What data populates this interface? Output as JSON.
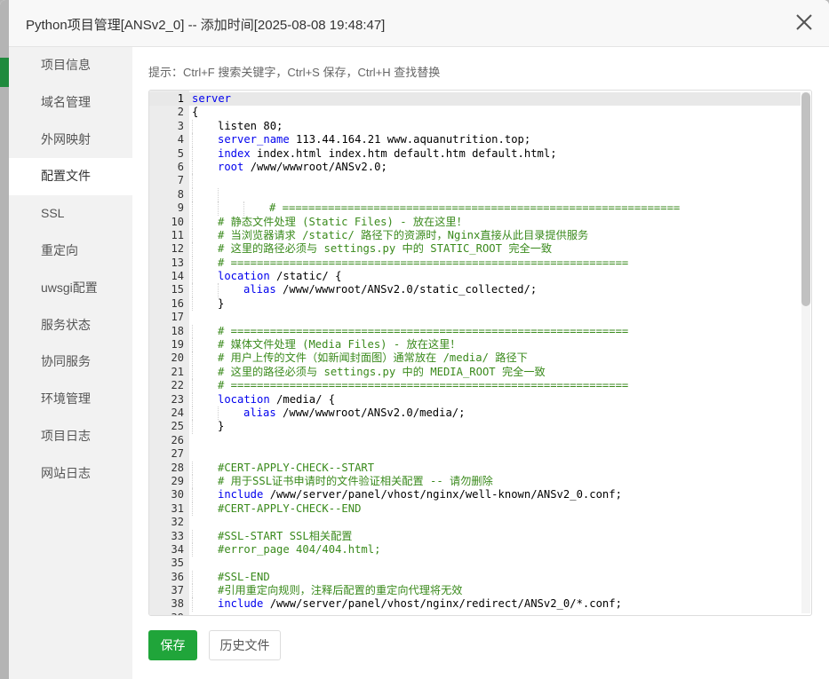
{
  "window": {
    "title": "Python项目管理[ANSv2_0] -- 添加时间[2025-08-08 19:48:47]"
  },
  "sidebar": {
    "items": [
      {
        "label": "项目信息",
        "active": false
      },
      {
        "label": "域名管理",
        "active": false
      },
      {
        "label": "外网映射",
        "active": false
      },
      {
        "label": "配置文件",
        "active": true
      },
      {
        "label": "SSL",
        "active": false
      },
      {
        "label": "重定向",
        "active": false
      },
      {
        "label": "uwsgi配置",
        "active": false
      },
      {
        "label": "服务状态",
        "active": false
      },
      {
        "label": "协同服务",
        "active": false
      },
      {
        "label": "环境管理",
        "active": false
      },
      {
        "label": "项目日志",
        "active": false
      },
      {
        "label": "网站日志",
        "active": false
      }
    ]
  },
  "editor": {
    "hint": "提示：Ctrl+F 搜索关键字，Ctrl+S 保存，Ctrl+H 查找替换",
    "active_line": 1,
    "scroll_fraction_visible": 0.41,
    "lines": [
      {
        "n": 1,
        "indent": 0,
        "segments": [
          [
            "kw",
            "server"
          ]
        ]
      },
      {
        "n": 2,
        "indent": 0,
        "segments": [
          [
            "t",
            "{"
          ]
        ]
      },
      {
        "n": 3,
        "indent": 1,
        "segments": [
          [
            "t",
            "listen 80;"
          ]
        ]
      },
      {
        "n": 4,
        "indent": 1,
        "segments": [
          [
            "kw",
            "server_name"
          ],
          [
            "t",
            " 113.44.164.21 www.aquanutrition.top;"
          ]
        ]
      },
      {
        "n": 5,
        "indent": 1,
        "segments": [
          [
            "kw",
            "index"
          ],
          [
            "t",
            " index.html index.htm default.htm default.html;"
          ]
        ]
      },
      {
        "n": 6,
        "indent": 1,
        "segments": [
          [
            "kw",
            "root"
          ],
          [
            "t",
            " /www/wwwroot/ANSv2.0;"
          ]
        ]
      },
      {
        "n": 7,
        "indent": 1,
        "segments": []
      },
      {
        "n": 8,
        "indent": 2,
        "segments": []
      },
      {
        "n": 9,
        "indent": 3,
        "segments": [
          [
            "cm",
            "# ============================================================="
          ]
        ]
      },
      {
        "n": 10,
        "indent": 1,
        "segments": [
          [
            "cm",
            "# 静态文件处理 (Static Files) - 放在这里！"
          ]
        ]
      },
      {
        "n": 11,
        "indent": 1,
        "segments": [
          [
            "cm",
            "# 当浏览器请求 /static/ 路径下的资源时，Nginx直接从此目录提供服务"
          ]
        ]
      },
      {
        "n": 12,
        "indent": 1,
        "segments": [
          [
            "cm",
            "# 这里的路径必须与 settings.py 中的 STATIC_ROOT 完全一致"
          ]
        ]
      },
      {
        "n": 13,
        "indent": 1,
        "segments": [
          [
            "cm",
            "# ============================================================="
          ]
        ]
      },
      {
        "n": 14,
        "indent": 1,
        "segments": [
          [
            "kw",
            "location"
          ],
          [
            "t",
            " /static/ {"
          ]
        ]
      },
      {
        "n": 15,
        "indent": 2,
        "segments": [
          [
            "kw",
            "alias"
          ],
          [
            "t",
            " /www/wwwroot/ANSv2.0/static_collected/;"
          ]
        ]
      },
      {
        "n": 16,
        "indent": 1,
        "segments": [
          [
            "t",
            "}"
          ]
        ]
      },
      {
        "n": 17,
        "indent": 0,
        "segments": []
      },
      {
        "n": 18,
        "indent": 1,
        "segments": [
          [
            "cm",
            "# ============================================================="
          ]
        ]
      },
      {
        "n": 19,
        "indent": 1,
        "segments": [
          [
            "cm",
            "# 媒体文件处理 (Media Files) - 放在这里！"
          ]
        ]
      },
      {
        "n": 20,
        "indent": 1,
        "segments": [
          [
            "cm",
            "# 用户上传的文件（如新闻封面图）通常放在 /media/ 路径下"
          ]
        ]
      },
      {
        "n": 21,
        "indent": 1,
        "segments": [
          [
            "cm",
            "# 这里的路径必须与 settings.py 中的 MEDIA_ROOT 完全一致"
          ]
        ]
      },
      {
        "n": 22,
        "indent": 1,
        "segments": [
          [
            "cm",
            "# ============================================================="
          ]
        ]
      },
      {
        "n": 23,
        "indent": 1,
        "segments": [
          [
            "kw",
            "location"
          ],
          [
            "t",
            " /media/ {"
          ]
        ]
      },
      {
        "n": 24,
        "indent": 2,
        "segments": [
          [
            "kw",
            "alias"
          ],
          [
            "t",
            " /www/wwwroot/ANSv2.0/media/;"
          ]
        ]
      },
      {
        "n": 25,
        "indent": 1,
        "segments": [
          [
            "t",
            "}"
          ]
        ]
      },
      {
        "n": 26,
        "indent": 0,
        "segments": []
      },
      {
        "n": 27,
        "indent": 0,
        "segments": []
      },
      {
        "n": 28,
        "indent": 1,
        "segments": [
          [
            "cm",
            "#CERT-APPLY-CHECK--START"
          ]
        ]
      },
      {
        "n": 29,
        "indent": 1,
        "segments": [
          [
            "cm",
            "# 用于SSL证书申请时的文件验证相关配置 -- 请勿删除"
          ]
        ]
      },
      {
        "n": 30,
        "indent": 1,
        "segments": [
          [
            "kw",
            "include"
          ],
          [
            "t",
            " /www/server/panel/vhost/nginx/well-known/ANSv2_0.conf;"
          ]
        ]
      },
      {
        "n": 31,
        "indent": 1,
        "segments": [
          [
            "cm",
            "#CERT-APPLY-CHECK--END"
          ]
        ]
      },
      {
        "n": 32,
        "indent": 0,
        "segments": []
      },
      {
        "n": 33,
        "indent": 1,
        "segments": [
          [
            "cm",
            "#SSL-START SSL相关配置"
          ]
        ]
      },
      {
        "n": 34,
        "indent": 1,
        "segments": [
          [
            "cm",
            "#error_page 404/404.html;"
          ]
        ]
      },
      {
        "n": 35,
        "indent": 0,
        "segments": []
      },
      {
        "n": 36,
        "indent": 1,
        "segments": [
          [
            "cm",
            "#SSL-END"
          ]
        ]
      },
      {
        "n": 37,
        "indent": 1,
        "segments": [
          [
            "cm",
            "#引用重定向规则，注释后配置的重定向代理将无效"
          ]
        ]
      },
      {
        "n": 38,
        "indent": 1,
        "segments": [
          [
            "kw",
            "include"
          ],
          [
            "t",
            " /www/server/panel/vhost/nginx/redirect/ANSv2_0/*.conf;"
          ]
        ]
      },
      {
        "n": 39,
        "indent": 0,
        "segments": []
      }
    ]
  },
  "buttons": {
    "save": "保存",
    "history": "历史文件"
  },
  "colors": {
    "primary": "#20a53a",
    "keyword": "#0000ee",
    "comment": "#3a8a1c"
  }
}
